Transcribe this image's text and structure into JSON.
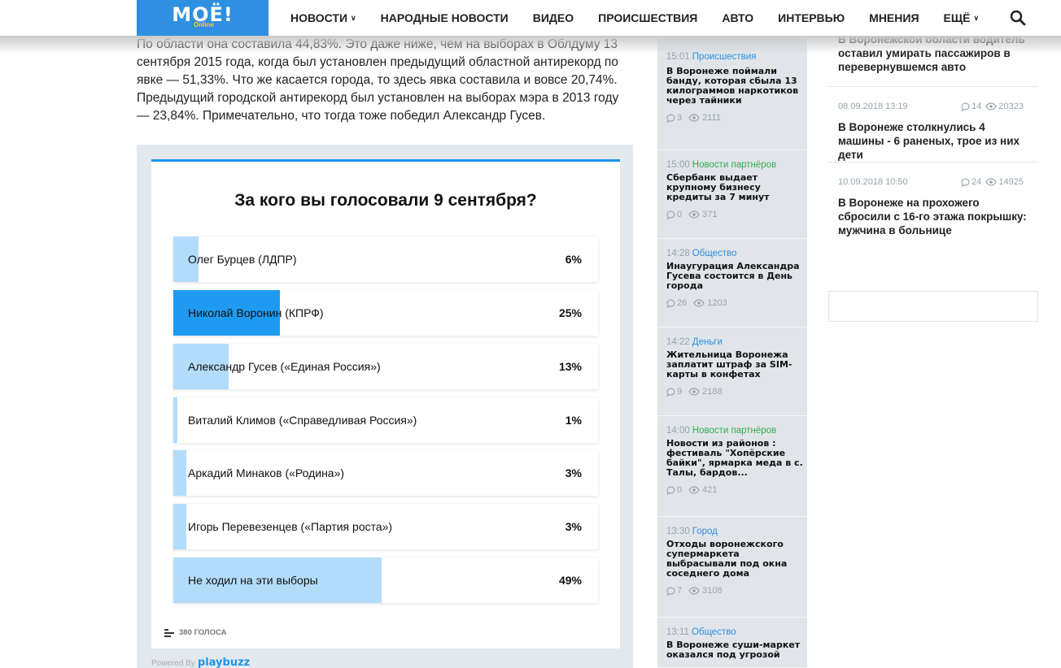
{
  "header": {
    "logo_main": "МОЁ!",
    "logo_sub": "Online",
    "nav": [
      {
        "label": "НОВОСТИ",
        "dropdown": true
      },
      {
        "label": "НАРОДНЫЕ НОВОСТИ",
        "dropdown": false
      },
      {
        "label": "ВИДЕО",
        "dropdown": false
      },
      {
        "label": "ПРОИСШЕСТВИЯ",
        "dropdown": false
      },
      {
        "label": "АВТО",
        "dropdown": false
      },
      {
        "label": "ИНТЕРВЬЮ",
        "dropdown": false
      },
      {
        "label": "МНЕНИЯ",
        "dropdown": false
      },
      {
        "label": "ЕЩЁ",
        "dropdown": true
      }
    ],
    "search_icon": "search-icon"
  },
  "article": {
    "paragraph": "По области она составила 44,83%. Это даже ниже, чем на выборах в Облдуму 13 сентября 2015 года, когда был установлен предыдущий областной антирекорд по явке — 51,33%. Что же касается города, то здесь явка составила и вовсе 20,74%. Предыдущий городской антирекорд был установлен на выборах мэра в 2013 году — 23,84%. Примечательно, что тогда тоже победил Александр Гусев."
  },
  "poll": {
    "title": "За кого вы голосовали 9 сентября?",
    "options": [
      {
        "label": "Олег Бурцев (ЛДПР)",
        "percent": "6%",
        "value": 6
      },
      {
        "label": "Николай Воронин (КПРФ)",
        "percent": "25%",
        "value": 25
      },
      {
        "label": "Александр Гусев («Единая Россия»)",
        "percent": "13%",
        "value": 13
      },
      {
        "label": "Виталий Климов («Справедливая Россия»)",
        "percent": "1%",
        "value": 1
      },
      {
        "label": "Аркадий Минаков («Родина»)",
        "percent": "3%",
        "value": 3
      },
      {
        "label": "Игорь Перевезенцев («Партия роста»)",
        "percent": "3%",
        "value": 3
      },
      {
        "label": "Не ходил на эти выборы",
        "percent": "49%",
        "value": 49
      }
    ],
    "votes": "380 ГОЛОСА",
    "powered_by": "Powered By",
    "powered_brand": "playbuzz",
    "colors": {
      "bar": "#b3dcfa",
      "bar_selected": "#1e9bf0",
      "accent": "#1a96e8"
    }
  },
  "feed": [
    {
      "time": "15:01",
      "category": "Происшествия",
      "partner": false,
      "title": "В Воронеже поймали банду, которая сбыла 13 килограммов наркотиков через тайники",
      "comments": "3",
      "views": "2111"
    },
    {
      "time": "15:00",
      "category": "Новости партнёров",
      "partner": true,
      "title": "Сбербанк выдает крупному бизнесу кредиты за 7 минут",
      "comments": "0",
      "views": "371"
    },
    {
      "time": "14:28",
      "category": "Общество",
      "partner": false,
      "title": "Инаугурация Александра Гусева состоится в День города",
      "comments": "26",
      "views": "1203"
    },
    {
      "time": "14:22",
      "category": "Деньги",
      "partner": false,
      "title": "Жительница Воронежа заплатит штраф за SIM-карты в конфетах",
      "comments": "9",
      "views": "2188"
    },
    {
      "time": "14:00",
      "category": "Новости партнёров",
      "partner": true,
      "title": "Новости из районов : фестиваль \"Хопёрские байки\", ярмарка меда в с. Талы, бардов...",
      "comments": "0",
      "views": "421"
    },
    {
      "time": "13:30",
      "category": "Город",
      "partner": false,
      "title": "Отходы воронежского супермаркета выбрасывали под окна соседнего дома",
      "comments": "7",
      "views": "3108"
    },
    {
      "time": "13:11",
      "category": "Общество",
      "partner": false,
      "title": "В Воронеже суши-маркет оказался под угрозой",
      "comments": "",
      "views": ""
    }
  ],
  "right_news": [
    {
      "date": "",
      "comments": "",
      "views": "",
      "title": "В Воронежской области водитель оставил умирать пассажиров в перевернувшемся авто"
    },
    {
      "date": "08.09.2018 13:19",
      "comments": "14",
      "views": "20323",
      "title": "В Воронеже столкнулись 4 машины - 6 раненых, трое из них дети"
    },
    {
      "date": "10.09.2018 10:50",
      "comments": "24",
      "views": "14925",
      "title": "В Воронеже на прохожего сбросили с 16-го этажа покрышку: мужчина в больнице"
    }
  ]
}
